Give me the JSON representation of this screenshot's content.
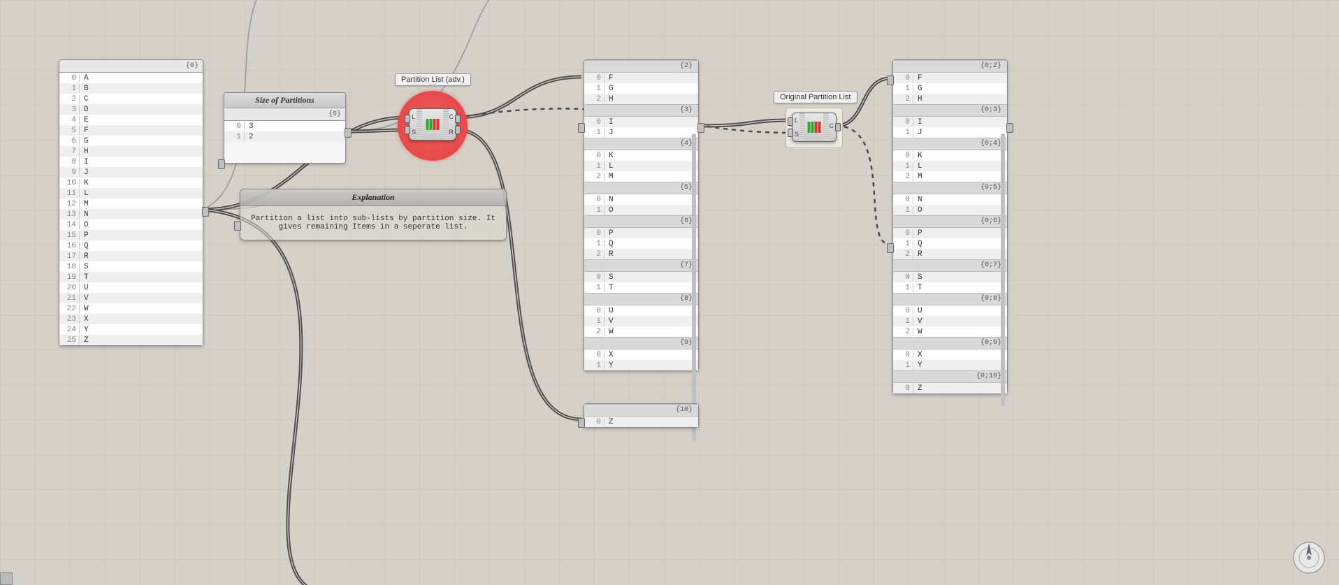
{
  "panels": {
    "alphabet": {
      "header_path": "{0}",
      "items": [
        {
          "i": "0",
          "v": "A"
        },
        {
          "i": "1",
          "v": "B"
        },
        {
          "i": "2",
          "v": "C"
        },
        {
          "i": "3",
          "v": "D"
        },
        {
          "i": "4",
          "v": "E"
        },
        {
          "i": "5",
          "v": "F"
        },
        {
          "i": "6",
          "v": "G"
        },
        {
          "i": "7",
          "v": "H"
        },
        {
          "i": "8",
          "v": "I"
        },
        {
          "i": "9",
          "v": "J"
        },
        {
          "i": "10",
          "v": "K"
        },
        {
          "i": "11",
          "v": "L"
        },
        {
          "i": "12",
          "v": "M"
        },
        {
          "i": "13",
          "v": "N"
        },
        {
          "i": "14",
          "v": "O"
        },
        {
          "i": "15",
          "v": "P"
        },
        {
          "i": "16",
          "v": "Q"
        },
        {
          "i": "17",
          "v": "R"
        },
        {
          "i": "18",
          "v": "S"
        },
        {
          "i": "19",
          "v": "T"
        },
        {
          "i": "20",
          "v": "U"
        },
        {
          "i": "21",
          "v": "V"
        },
        {
          "i": "22",
          "v": "W"
        },
        {
          "i": "23",
          "v": "X"
        },
        {
          "i": "24",
          "v": "Y"
        },
        {
          "i": "25",
          "v": "Z"
        }
      ]
    },
    "sizes": {
      "title": "Size of Partitions",
      "header_path": "{0}",
      "items": [
        {
          "i": "0",
          "v": "3"
        },
        {
          "i": "1",
          "v": "2"
        }
      ]
    },
    "result_left_branches": [
      {
        "path": "{2}",
        "items": [
          {
            "i": "0",
            "v": "F"
          },
          {
            "i": "1",
            "v": "G"
          },
          {
            "i": "2",
            "v": "H"
          }
        ]
      },
      {
        "path": "{3}",
        "items": [
          {
            "i": "0",
            "v": "I"
          },
          {
            "i": "1",
            "v": "J"
          }
        ]
      },
      {
        "path": "{4}",
        "items": [
          {
            "i": "0",
            "v": "K"
          },
          {
            "i": "1",
            "v": "L"
          },
          {
            "i": "2",
            "v": "M"
          }
        ]
      },
      {
        "path": "{5}",
        "items": [
          {
            "i": "0",
            "v": "N"
          },
          {
            "i": "1",
            "v": "O"
          }
        ]
      },
      {
        "path": "{6}",
        "items": [
          {
            "i": "0",
            "v": "P"
          },
          {
            "i": "1",
            "v": "Q"
          },
          {
            "i": "2",
            "v": "R"
          }
        ]
      },
      {
        "path": "{7}",
        "items": [
          {
            "i": "0",
            "v": "S"
          },
          {
            "i": "1",
            "v": "T"
          }
        ]
      },
      {
        "path": "{8}",
        "items": [
          {
            "i": "0",
            "v": "U"
          },
          {
            "i": "1",
            "v": "V"
          },
          {
            "i": "2",
            "v": "W"
          }
        ]
      },
      {
        "path": "{9}",
        "items": [
          {
            "i": "0",
            "v": "X"
          },
          {
            "i": "1",
            "v": "Y"
          }
        ]
      }
    ],
    "result_left_remainder": {
      "path": "{10}",
      "items": [
        {
          "i": "0",
          "v": "Z"
        }
      ]
    },
    "result_right_branches": [
      {
        "path": "{0;2}",
        "items": [
          {
            "i": "0",
            "v": "F"
          },
          {
            "i": "1",
            "v": "G"
          },
          {
            "i": "2",
            "v": "H"
          }
        ]
      },
      {
        "path": "{0;3}",
        "items": [
          {
            "i": "0",
            "v": "I"
          },
          {
            "i": "1",
            "v": "J"
          }
        ]
      },
      {
        "path": "{0;4}",
        "items": [
          {
            "i": "0",
            "v": "K"
          },
          {
            "i": "1",
            "v": "L"
          },
          {
            "i": "2",
            "v": "M"
          }
        ]
      },
      {
        "path": "{0;5}",
        "items": [
          {
            "i": "0",
            "v": "N"
          },
          {
            "i": "1",
            "v": "O"
          }
        ]
      },
      {
        "path": "{0;6}",
        "items": [
          {
            "i": "0",
            "v": "P"
          },
          {
            "i": "1",
            "v": "Q"
          },
          {
            "i": "2",
            "v": "R"
          }
        ]
      },
      {
        "path": "{0;7}",
        "items": [
          {
            "i": "0",
            "v": "S"
          },
          {
            "i": "1",
            "v": "T"
          }
        ]
      },
      {
        "path": "{0;8}",
        "items": [
          {
            "i": "0",
            "v": "U"
          },
          {
            "i": "1",
            "v": "V"
          },
          {
            "i": "2",
            "v": "W"
          }
        ]
      },
      {
        "path": "{0;9}",
        "items": [
          {
            "i": "0",
            "v": "X"
          },
          {
            "i": "1",
            "v": "Y"
          }
        ]
      },
      {
        "path": "{0;10}",
        "items": [
          {
            "i": "0",
            "v": "Z"
          }
        ]
      }
    ]
  },
  "labels": {
    "partition_adv": "Partition List (adv.)",
    "original_partition": "Original Partition List"
  },
  "components": {
    "partition_adv": {
      "in": [
        "L",
        "S"
      ],
      "out": [
        "C",
        "R"
      ]
    },
    "original_partition": {
      "in": [
        "L",
        "S"
      ],
      "out": [
        "C"
      ]
    }
  },
  "explanation": {
    "title": "Explanation",
    "body": "Partition a list into sub-lists by partition size. It gives remaining Items in a seperate list."
  },
  "colors": {
    "error_ring": "#e84b4b",
    "accent_green": "#2eab2e",
    "accent_red": "#d33"
  }
}
